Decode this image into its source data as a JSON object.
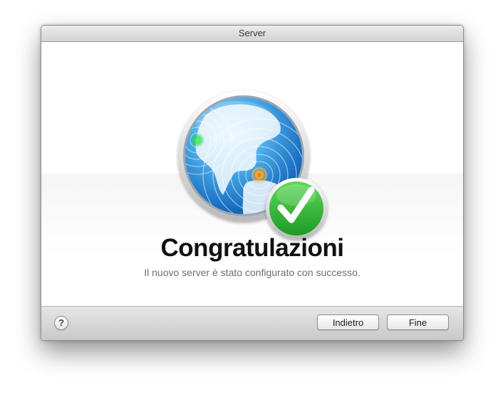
{
  "window": {
    "title": "Server"
  },
  "main": {
    "heading": "Congratulazioni",
    "subtitle": "Il nuovo server è stato configurato con successo."
  },
  "icons": {
    "app_icon": "server-globe-icon",
    "badge_icon": "checkmark-icon",
    "help_icon": "help-icon"
  },
  "footer": {
    "help_label": "?",
    "back_label": "Indietro",
    "done_label": "Fine"
  },
  "colors": {
    "check_badge": "#2fb52f",
    "globe_blue": "#1f78c8"
  }
}
